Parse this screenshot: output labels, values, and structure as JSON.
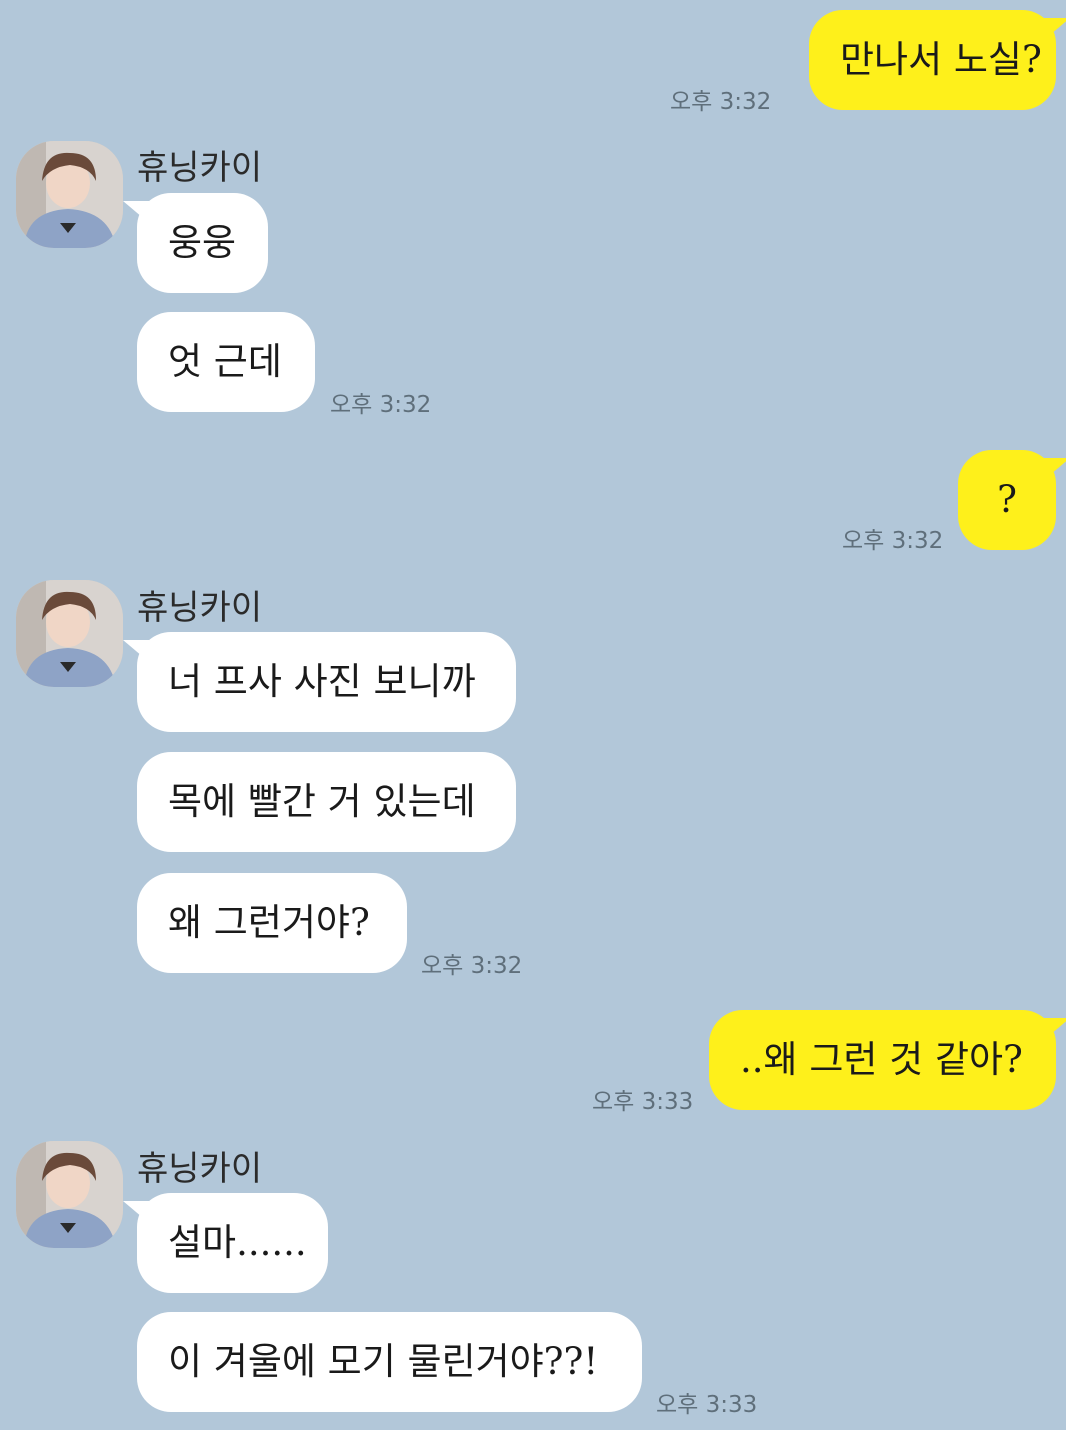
{
  "chat": {
    "sender_name": "휴닝카이",
    "msg1": {
      "text": "만나서 노실?",
      "time": "오후 3:32"
    },
    "msg2": {
      "text": "웅웅"
    },
    "msg3": {
      "text": "엇 근데",
      "time": "오후 3:32"
    },
    "msg4": {
      "text": "?",
      "time": "오후 3:32"
    },
    "msg5": {
      "text": "너 프사 사진 보니까"
    },
    "msg6": {
      "text": "목에 빨간 거 있는데"
    },
    "msg7": {
      "text": "왜 그런거야?",
      "time": "오후 3:32"
    },
    "msg8": {
      "text": "..왜 그런 것 같아?",
      "time": "오후 3:33"
    },
    "msg9": {
      "text": "설마......"
    },
    "msg10": {
      "text": "이 겨울에 모기 물린거야??!",
      "time": "오후 3:33"
    }
  },
  "colors": {
    "background": "#b2c7d9",
    "my_bubble": "#fef01b",
    "their_bubble": "#ffffff"
  },
  "icons": {
    "avatar": "profile-photo"
  }
}
